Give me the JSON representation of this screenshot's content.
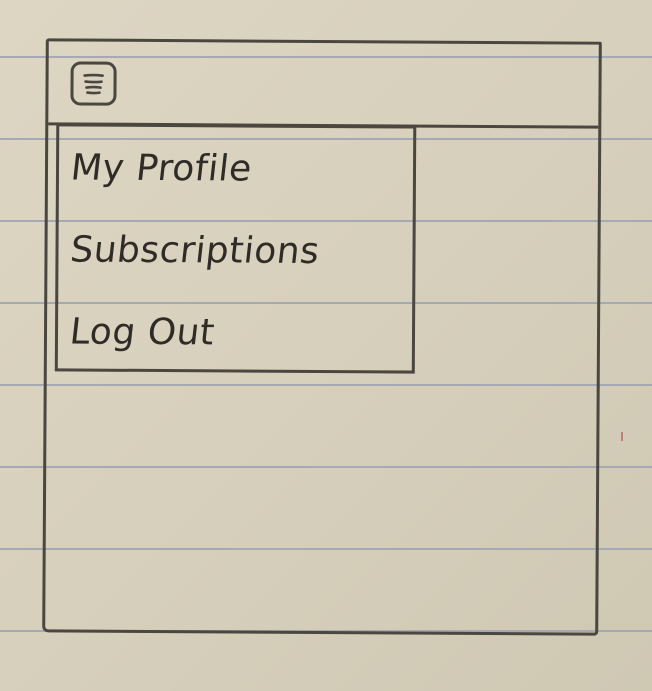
{
  "header": {
    "menu_icon": "hamburger-menu-icon"
  },
  "menu": {
    "items": [
      {
        "label": "My Profile"
      },
      {
        "label": "Subscriptions"
      },
      {
        "label": "Log Out"
      }
    ]
  },
  "colors": {
    "paper": "#d9d2bf",
    "ruled_line": "#a6a8b4",
    "ink": "#4a4640",
    "margin_tick": "#c45858"
  }
}
